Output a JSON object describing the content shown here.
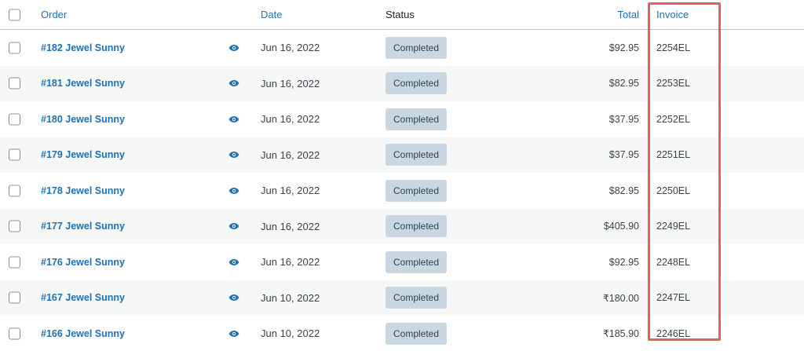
{
  "header": {
    "order": "Order",
    "date": "Date",
    "status": "Status",
    "total": "Total",
    "invoice": "Invoice"
  },
  "rows": [
    {
      "order": "#182 Jewel Sunny",
      "date": "Jun 16, 2022",
      "status": "Completed",
      "total": "$92.95",
      "invoice": "2254EL"
    },
    {
      "order": "#181 Jewel Sunny",
      "date": "Jun 16, 2022",
      "status": "Completed",
      "total": "$82.95",
      "invoice": "2253EL"
    },
    {
      "order": "#180 Jewel Sunny",
      "date": "Jun 16, 2022",
      "status": "Completed",
      "total": "$37.95",
      "invoice": "2252EL"
    },
    {
      "order": "#179 Jewel Sunny",
      "date": "Jun 16, 2022",
      "status": "Completed",
      "total": "$37.95",
      "invoice": "2251EL"
    },
    {
      "order": "#178 Jewel Sunny",
      "date": "Jun 16, 2022",
      "status": "Completed",
      "total": "$82.95",
      "invoice": "2250EL"
    },
    {
      "order": "#177 Jewel Sunny",
      "date": "Jun 16, 2022",
      "status": "Completed",
      "total": "$405.90",
      "invoice": "2249EL"
    },
    {
      "order": "#176 Jewel Sunny",
      "date": "Jun 16, 2022",
      "status": "Completed",
      "total": "$92.95",
      "invoice": "2248EL"
    },
    {
      "order": "#167 Jewel Sunny",
      "date": "Jun 10, 2022",
      "status": "Completed",
      "total": "₹180.00",
      "invoice": "2247EL"
    },
    {
      "order": "#166 Jewel Sunny",
      "date": "Jun 10, 2022",
      "status": "Completed",
      "total": "₹185.90",
      "invoice": "2246EL"
    }
  ],
  "colors": {
    "link": "#2271b1",
    "status_bg": "#c8d7e1",
    "highlight": "#e0625c"
  },
  "icons": {
    "preview": "eye-icon"
  }
}
